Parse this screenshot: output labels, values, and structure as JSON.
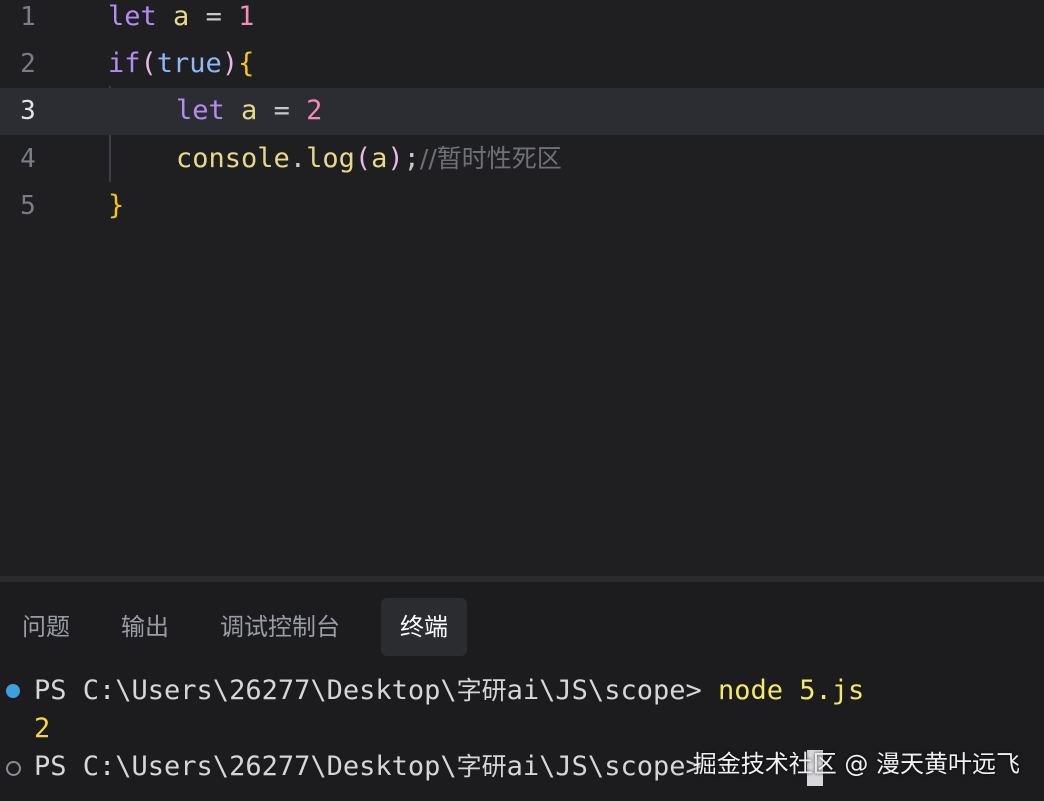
{
  "editor": {
    "lines": [
      {
        "num": "1",
        "tokens": [
          "let",
          "a",
          "=",
          "1"
        ]
      },
      {
        "num": "2",
        "tokens": [
          "if",
          "(",
          "true",
          ")",
          "{"
        ]
      },
      {
        "num": "3",
        "tokens": [
          "let",
          "a",
          "=",
          "2"
        ]
      },
      {
        "num": "4",
        "tokens": [
          "console",
          ".",
          "log",
          "(",
          "a",
          ")",
          ";",
          "//暂时性死区"
        ]
      },
      {
        "num": "5",
        "tokens": [
          "}"
        ]
      }
    ],
    "active_line": "3"
  },
  "panel": {
    "tabs": [
      "问题",
      "输出",
      "调试控制台",
      "终端"
    ],
    "active_tab": "终端"
  },
  "terminal": {
    "prompt1_prefix": "PS C:\\Users\\26277\\Desktop\\",
    "prompt1_cjk": "字研",
    "prompt1_suffix": "ai\\JS\\scope> ",
    "command": "node 5.js",
    "output": "2",
    "prompt2_prefix": "PS C:\\Users\\26277\\Desktop\\",
    "prompt2_cjk": "字研",
    "prompt2_suffix": "ai\\JS\\scope>"
  },
  "watermark": "掘金技术社区 @ 漫天黄叶远飞",
  "colors": {
    "keyword": "#b48cf2",
    "variable": "#e6d98a",
    "number": "#f38ab8",
    "boolean": "#8fb8f5",
    "brace": "#f5c518",
    "comment": "#6f7179",
    "terminal_command": "#f2ea68",
    "status_dot": "#3d9fe0"
  }
}
